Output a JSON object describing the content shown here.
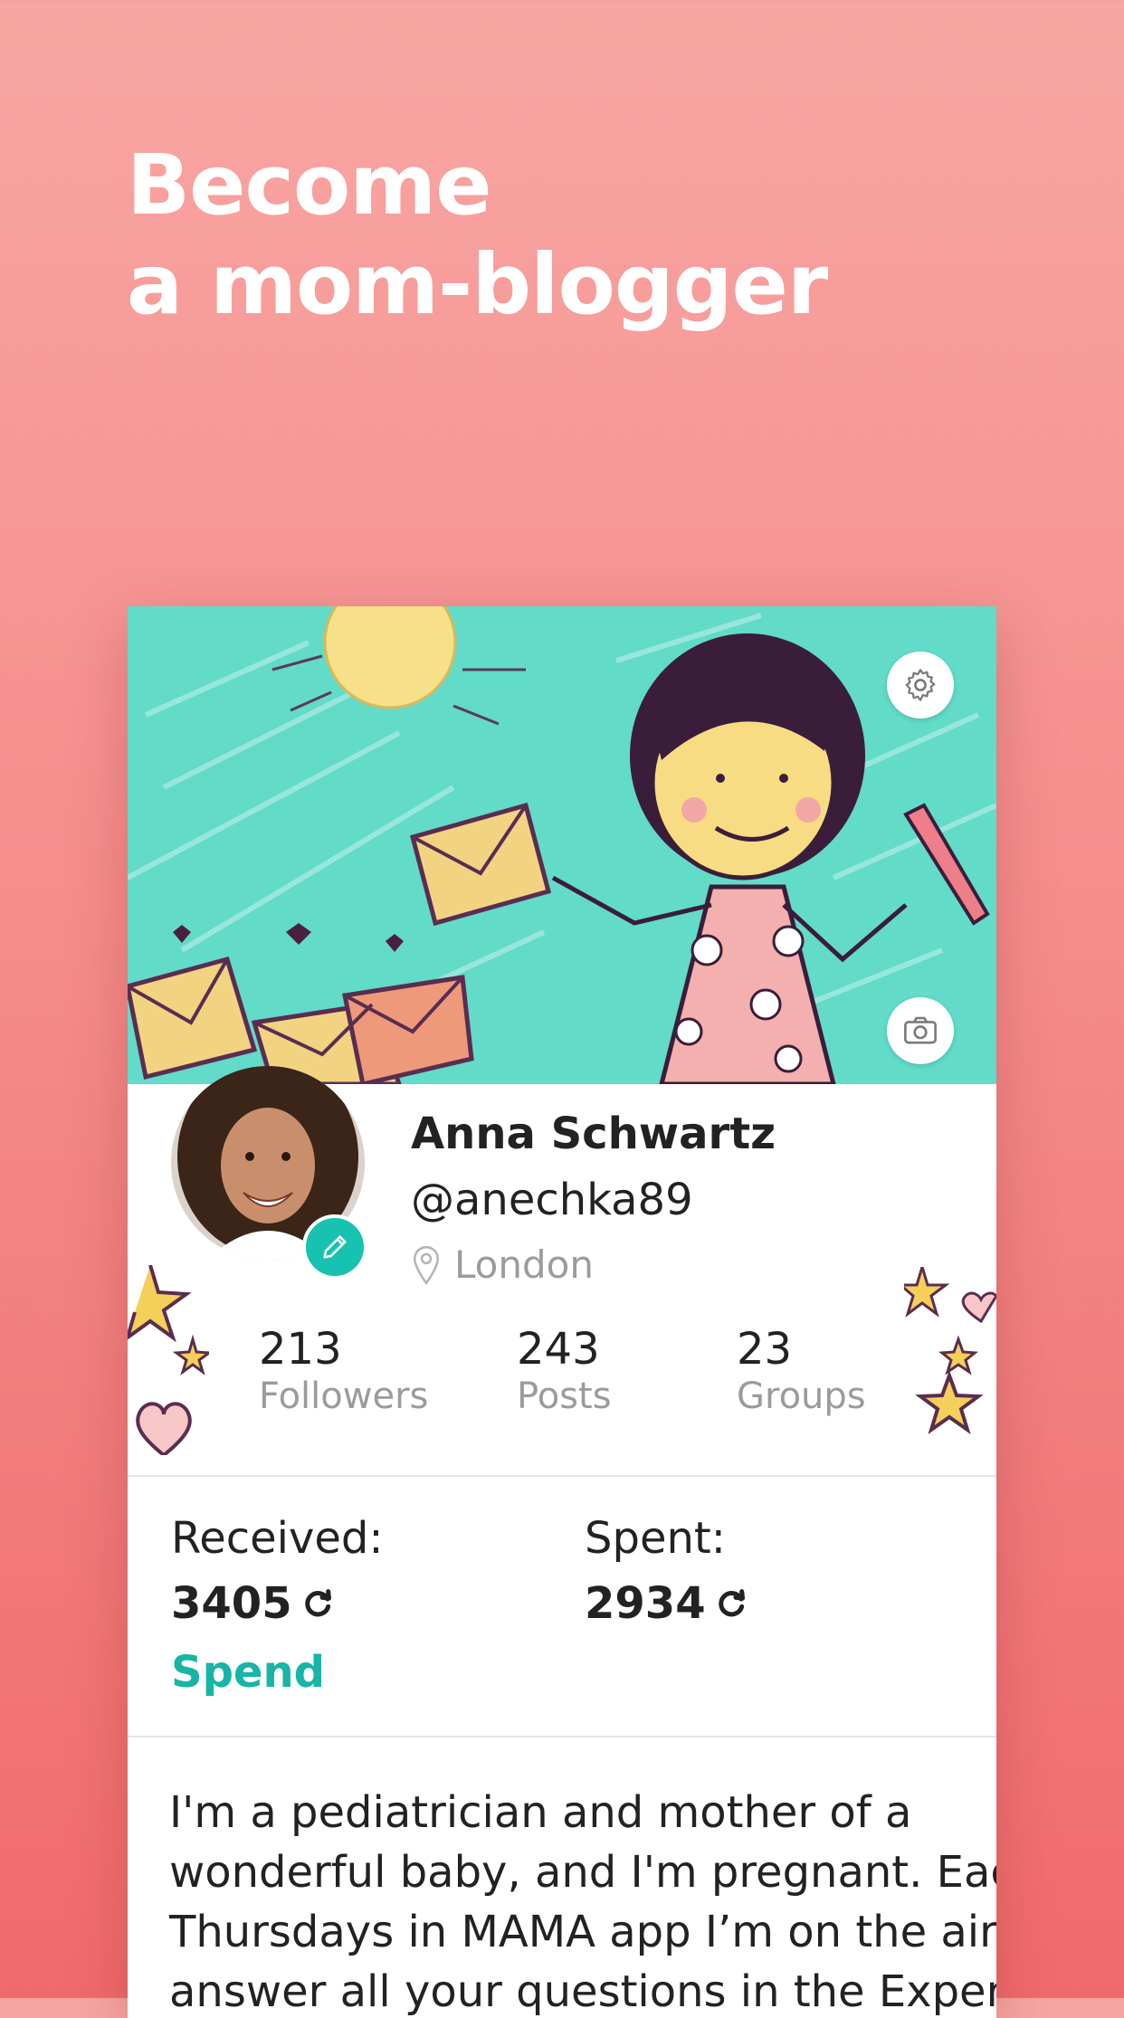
{
  "headline": {
    "line1": "Become",
    "line2": "a mom-blogger"
  },
  "profile": {
    "name": "Anna Schwartz",
    "handle": "@anechka89",
    "location": "London"
  },
  "stats": [
    {
      "value": "213",
      "label": "Followers"
    },
    {
      "value": "243",
      "label": "Posts"
    },
    {
      "value": "23",
      "label": "Groups"
    }
  ],
  "balance": {
    "received_label": "Received:",
    "received_value": "3405",
    "spent_label": "Spent:",
    "spent_value": "2934",
    "currency_icon": "coin-refresh-icon"
  },
  "spend_label": "Spend",
  "bio_lines": [
    "I'm a pediatrician and mother of a",
    "wonderful baby, and I'm pregnant. Each",
    "Thursdays in MAMA app I’m on the air",
    "answer all your questions in the Expert"
  ],
  "icons": {
    "settings": "gear-icon",
    "camera": "camera-icon",
    "edit": "pencil-icon",
    "location": "location-pin-icon"
  },
  "colors": {
    "background_top": "#f8a6a3",
    "background_bottom": "#f06a6d",
    "cover": "#62dbc9",
    "accent": "#17c2b1",
    "spend_link": "#17b5a5"
  }
}
